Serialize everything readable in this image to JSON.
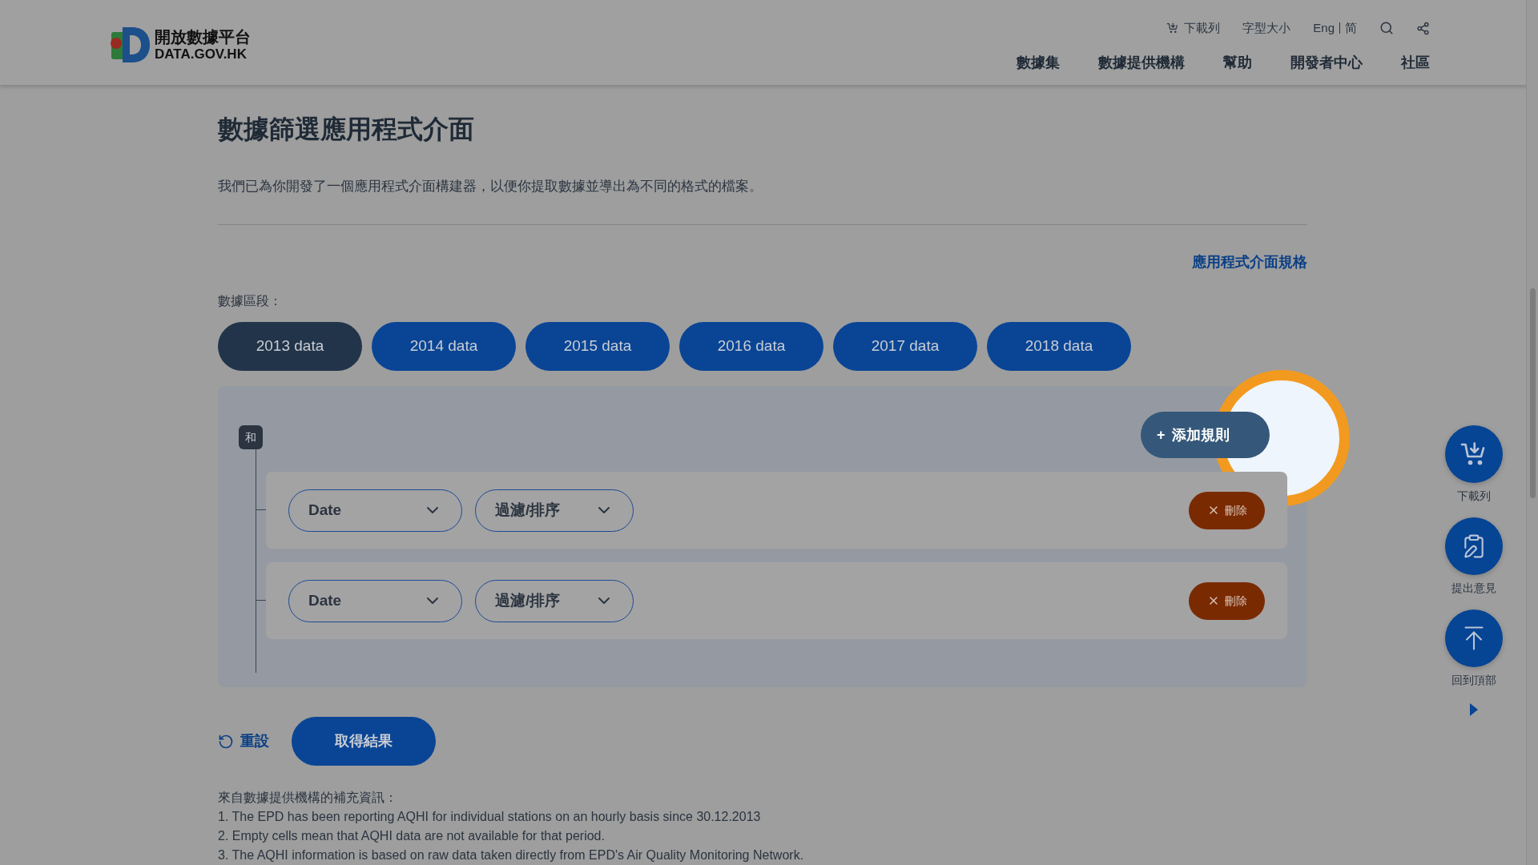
{
  "header": {
    "logo": {
      "title": "開放數據平台",
      "subtitle": "DATA.GOV.HK"
    },
    "utility": [
      {
        "kind": "cart",
        "label": "下載列"
      },
      {
        "kind": "text",
        "label": "字型大小"
      }
    ],
    "languages": [
      "Eng",
      "简"
    ],
    "nav": [
      "數據集",
      "數據提供機構",
      "幫助",
      "開發者中心",
      "社區"
    ]
  },
  "page": {
    "title": "數據篩選應用程式介面",
    "description": "我們已為你開發了一個應用程式介面構建器，以便你提取數據並導出為不同的格式的檔案。",
    "spec_link": "應用程式介面規格",
    "segment_label": "數據區段：",
    "segments": [
      {
        "label": "2013 data",
        "selected": true
      },
      {
        "label": "2014 data",
        "selected": false
      },
      {
        "label": "2015 data",
        "selected": false
      },
      {
        "label": "2016 data",
        "selected": false
      },
      {
        "label": "2017 data",
        "selected": false
      },
      {
        "label": "2018 data",
        "selected": false
      }
    ],
    "builder": {
      "operator": "和",
      "add_button": {
        "icon": "+",
        "label": "添加規則",
        "highlighted": true
      },
      "rules": [
        {
          "field": "Date",
          "operation": "過濾/排序",
          "delete": "刪除"
        },
        {
          "field": "Date",
          "operation": "過濾/排序",
          "delete": "刪除"
        }
      ]
    },
    "reset": "重設",
    "submit": "取得結果",
    "notes": {
      "heading": "來自數據提供機構的補充資訊：",
      "lines": [
        "1. The EPD has been reporting AQHI for individual stations on an hourly basis since 30.12.2013",
        "2. Empty cells mean that AQHI data are not available for that period.",
        "3. The AQHI information is based on raw data taken directly from EPD's Air Quality Monitoring Network."
      ]
    }
  },
  "float_buttons": [
    {
      "kind": "cart",
      "label": "下載列"
    },
    {
      "kind": "feedback",
      "label": "提出意見"
    },
    {
      "kind": "top",
      "label": "回到頂部"
    }
  ]
}
